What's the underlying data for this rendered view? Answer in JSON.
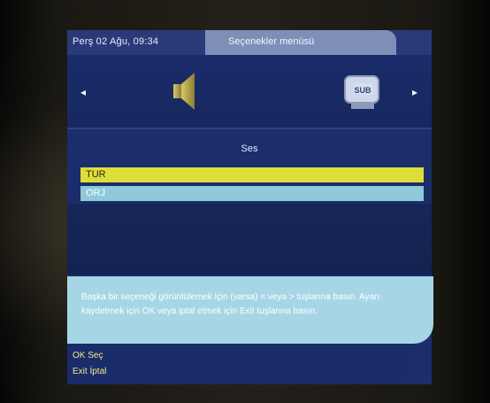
{
  "header": {
    "datetime": "Perş 02 Ağu, 09:34",
    "title": "Seçenekler menüsü"
  },
  "icons": {
    "left_arrow": "◂",
    "right_arrow": "▸",
    "sub_label": "SUB"
  },
  "section": {
    "label": "Ses"
  },
  "options": [
    {
      "label": "TUR",
      "selected": true
    },
    {
      "label": "ORJ",
      "selected": false
    }
  ],
  "info": {
    "text": "Başka bir seçeneği görüntülemek için (varsa) < veya > tuşlarına basın. Ayarı kaydetmek için OK veya iptal etmek için Exit tuşlarına basın."
  },
  "footer": {
    "ok_hint": "OK Seç",
    "exit_hint": "Exit İptal"
  },
  "colors": {
    "panel": "#1b2d6a",
    "title_tab": "#7d8fb7",
    "selected_row": "#dede3a",
    "normal_row": "#8ecad9",
    "info_box": "#a6d6e6",
    "hint_text": "#f0e98a"
  }
}
